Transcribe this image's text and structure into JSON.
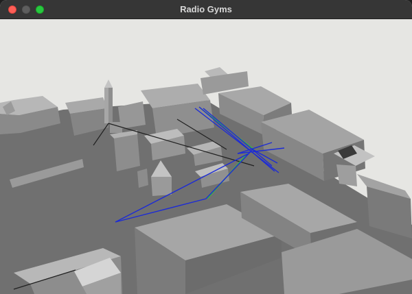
{
  "window": {
    "title": "Radio Gyms"
  },
  "icons": {
    "close": "close-icon",
    "minimize": "minimize-icon",
    "zoom": "zoom-icon"
  },
  "colors": {
    "titlebar": "#363636",
    "title_text": "#d8d8d8",
    "close": "#fe5f57",
    "minimize": "#5e5e5e",
    "zoom": "#28c840",
    "sky": "#e6e6e3",
    "ground": "#707070",
    "building_top": "#aaaaaa",
    "building_side": "#7e7e7e",
    "ray_blue": "#1c2bd6",
    "ray_green": "#2fbf3a",
    "ray_black": "#202020"
  }
}
